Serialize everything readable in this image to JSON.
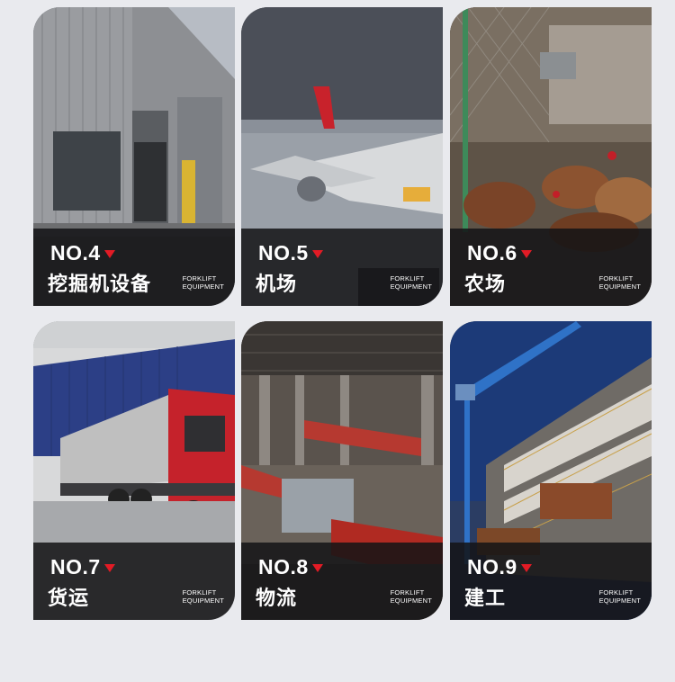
{
  "cards": [
    {
      "number": "NO.4",
      "name": "挖掘机设备",
      "brand_line1": "FORKLIFT",
      "brand_line2": "EQUIPMENT"
    },
    {
      "number": "NO.5",
      "name": "机场",
      "brand_line1": "FORKLIFT",
      "brand_line2": "EQUIPMENT"
    },
    {
      "number": "NO.6",
      "name": "农场",
      "brand_line1": "FORKLIFT",
      "brand_line2": "EQUIPMENT"
    },
    {
      "number": "NO.7",
      "name": "货运",
      "brand_line1": "FORKLIFT",
      "brand_line2": "EQUIPMENT"
    },
    {
      "number": "NO.8",
      "name": "物流",
      "brand_line1": "FORKLIFT",
      "brand_line2": "EQUIPMENT"
    },
    {
      "number": "NO.9",
      "name": "建工",
      "brand_line1": "FORKLIFT",
      "brand_line2": "EQUIPMENT"
    }
  ],
  "colors": {
    "background": "#e9eaee",
    "accent_triangle": "#e21b25",
    "caption_band": "#141416"
  },
  "icons": [
    "red-down-triangle-icon"
  ]
}
